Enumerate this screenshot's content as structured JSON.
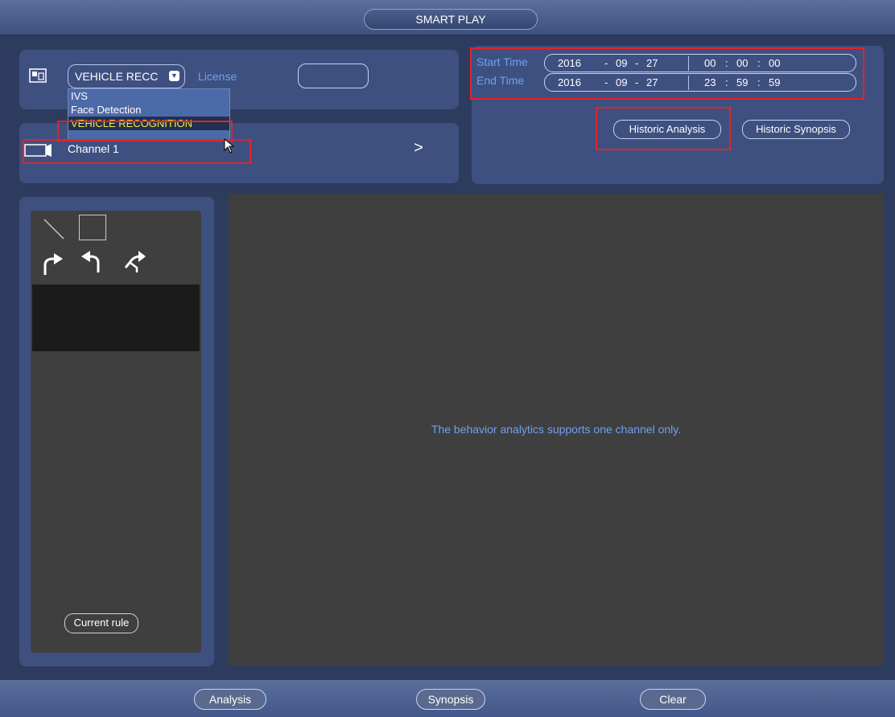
{
  "window": {
    "title": "SMART PLAY"
  },
  "mode": {
    "selected": "VEHICLE RECC",
    "license_label": "License",
    "license_value": "",
    "options": [
      "IVS",
      "Face Detection",
      "VEHICLE RECOGNITION"
    ]
  },
  "channel": {
    "label": "Channel 1",
    "next_symbol": ">"
  },
  "time": {
    "start_label": "Start Time",
    "end_label": "End Time",
    "start": {
      "year": "2016",
      "month": "09",
      "day": "27",
      "hour": "00",
      "minute": "00",
      "second": "00"
    },
    "end": {
      "year": "2016",
      "month": "09",
      "day": "27",
      "hour": "23",
      "minute": "59",
      "second": "59"
    },
    "date_sep": "-",
    "time_sep": ":"
  },
  "buttons": {
    "historic_analysis": "Historic Analysis",
    "historic_synopsis": "Historic Synopsis",
    "current_rule": "Current rule",
    "analysis": "Analysis",
    "synopsis": "Synopsis",
    "clear": "Clear"
  },
  "video": {
    "message": "The behavior analytics supports one channel only."
  },
  "colors": {
    "highlight": "#e3222c",
    "accent_text": "#6fa0f0",
    "selected_option_text": "#f3ea3b"
  },
  "icons": [
    "mode-icon",
    "camera-icon",
    "line-tool-icon",
    "rect-tool-icon",
    "redo-icon",
    "undo-icon",
    "swap-icon",
    "cursor-icon"
  ]
}
